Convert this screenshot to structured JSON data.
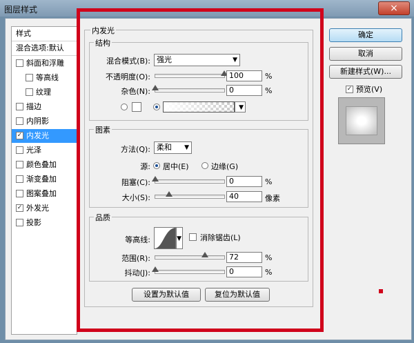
{
  "window": {
    "title": "图层样式",
    "close": "×"
  },
  "left_panel": {
    "header": "样式",
    "blend_defaults": "混合选项:默认",
    "items": [
      {
        "label": "斜面和浮雕",
        "checked": false
      },
      {
        "label": "等高线",
        "checked": false
      },
      {
        "label": "纹理",
        "checked": false
      },
      {
        "label": "描边",
        "checked": false
      },
      {
        "label": "内阴影",
        "checked": false
      },
      {
        "label": "内发光",
        "checked": true
      },
      {
        "label": "光泽",
        "checked": false
      },
      {
        "label": "颜色叠加",
        "checked": false
      },
      {
        "label": "渐变叠加",
        "checked": false
      },
      {
        "label": "图案叠加",
        "checked": false
      },
      {
        "label": "外发光",
        "checked": true
      },
      {
        "label": "投影",
        "checked": false
      }
    ]
  },
  "inner_glow": {
    "title": "内发光",
    "structure": {
      "title": "结构",
      "blend_mode_label": "混合模式(B):",
      "blend_mode_value": "强光",
      "opacity_label": "不透明度(O):",
      "opacity_value": "100",
      "opacity_percent": 100,
      "noise_label": "杂色(N):",
      "noise_value": "0",
      "noise_percent": 0,
      "unit": "%"
    },
    "elements": {
      "title": "图素",
      "technique_label": "方法(Q):",
      "technique_value": "柔和",
      "source_label": "源:",
      "source_center": "居中(E)",
      "source_edge": "边缘(G)",
      "choke_label": "阻塞(C):",
      "choke_value": "0",
      "choke_percent": 0,
      "size_label": "大小(S):",
      "size_value": "40",
      "size_unit": "像素",
      "unit": "%"
    },
    "quality": {
      "title": "品质",
      "contour_label": "等高线:",
      "antialias_label": "消除锯齿(L)",
      "range_label": "范围(R):",
      "range_value": "72",
      "range_percent": 72,
      "jitter_label": "抖动(J):",
      "jitter_value": "0",
      "jitter_percent": 0,
      "unit": "%"
    },
    "make_default": "设置为默认值",
    "reset_default": "复位为默认值"
  },
  "right_panel": {
    "ok": "确定",
    "cancel": "取消",
    "new_style": "新建样式(W)...",
    "preview_label": "预览(V)",
    "preview_checked": true
  },
  "colors": {
    "accent": "#d0021b",
    "selection": "#3399ff"
  }
}
